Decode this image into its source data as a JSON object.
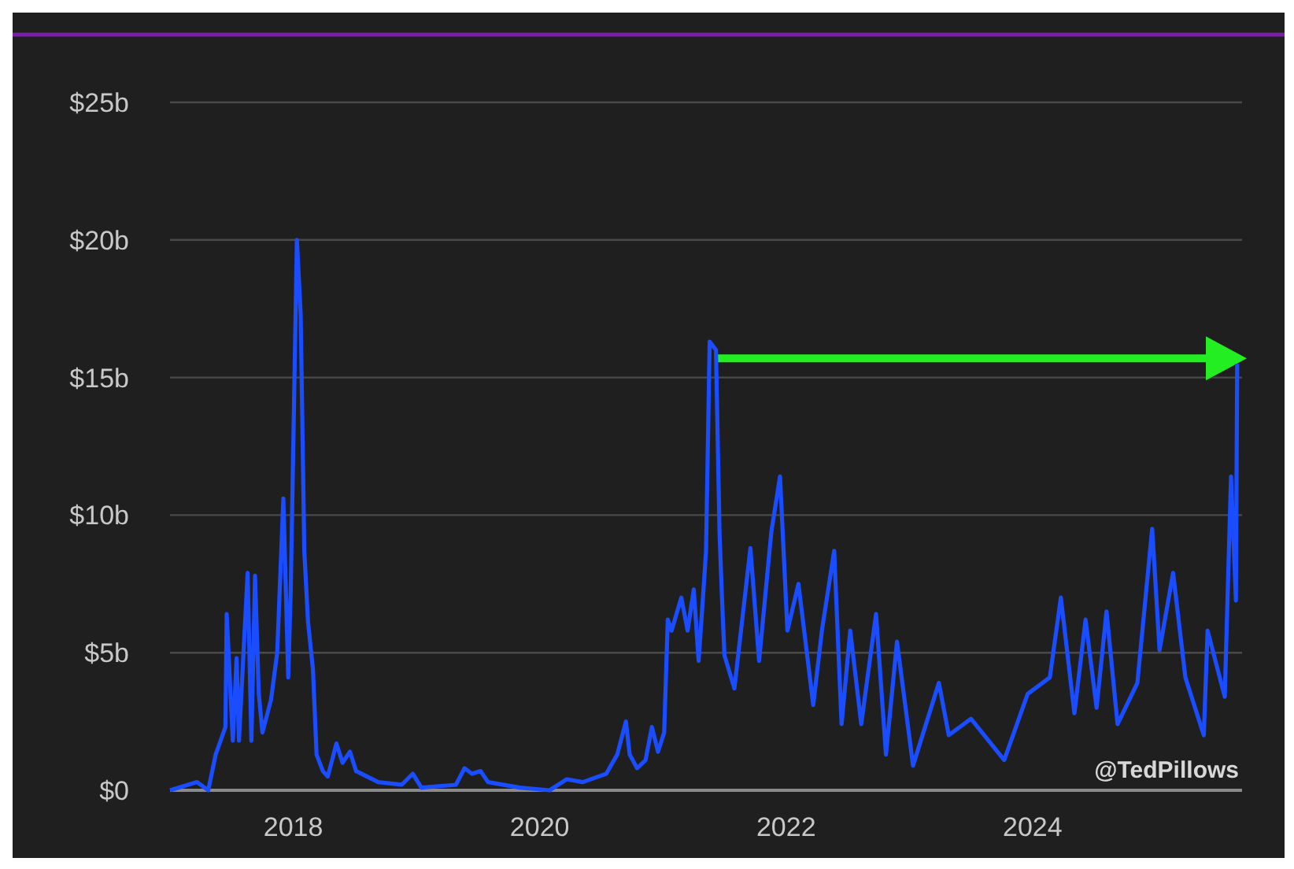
{
  "chart_data": {
    "type": "line",
    "xlim": [
      2017,
      2025.7
    ],
    "ylim": [
      0,
      25
    ],
    "yticks": [
      {
        "value": 0,
        "label": "$0"
      },
      {
        "value": 5,
        "label": "$5b"
      },
      {
        "value": 10,
        "label": "$10b"
      },
      {
        "value": 15,
        "label": "$15b"
      },
      {
        "value": 20,
        "label": "$20b"
      },
      {
        "value": 25,
        "label": "$25b"
      }
    ],
    "xticks": [
      {
        "value": 2018,
        "label": "2018"
      },
      {
        "value": 2020,
        "label": "2020"
      },
      {
        "value": 2022,
        "label": "2022"
      },
      {
        "value": 2024,
        "label": "2024"
      }
    ],
    "x": [
      2017.0,
      2017.22,
      2017.31,
      2017.37,
      2017.45,
      2017.46,
      2017.51,
      2017.54,
      2017.56,
      2017.63,
      2017.66,
      2017.69,
      2017.72,
      2017.75,
      2017.82,
      2017.87,
      2017.92,
      2017.96,
      2017.98,
      2018.03,
      2018.06,
      2018.09,
      2018.12,
      2018.16,
      2018.19,
      2018.24,
      2018.28,
      2018.35,
      2018.4,
      2018.46,
      2018.51,
      2018.69,
      2018.88,
      2018.97,
      2019.04,
      2019.32,
      2019.39,
      2019.45,
      2019.52,
      2019.58,
      2019.84,
      2020.08,
      2020.15,
      2020.22,
      2020.35,
      2020.54,
      2020.63,
      2020.7,
      2020.73,
      2020.79,
      2020.86,
      2020.91,
      2020.96,
      2021.01,
      2021.04,
      2021.07,
      2021.15,
      2021.2,
      2021.25,
      2021.29,
      2021.33,
      2021.35,
      2021.38,
      2021.43,
      2021.46,
      2021.48,
      2021.5,
      2021.58,
      2021.71,
      2021.78,
      2021.88,
      2021.95,
      2022.01,
      2022.1,
      2022.22,
      2022.29,
      2022.39,
      2022.45,
      2022.52,
      2022.61,
      2022.73,
      2022.81,
      2022.9,
      2023.03,
      2023.24,
      2023.32,
      2023.5,
      2023.77,
      2023.96,
      2024.14,
      2024.23,
      2024.34,
      2024.43,
      2024.52,
      2024.6,
      2024.69,
      2024.85,
      2024.97,
      2025.03,
      2025.14,
      2025.24,
      2025.39,
      2025.42,
      2025.56,
      2025.61,
      2025.65,
      2025.66
    ],
    "series": [
      {
        "color": "#1a4dff",
        "values": [
          0,
          0.3,
          0,
          1.3,
          2.3,
          6.4,
          1.8,
          4.8,
          1.8,
          7.9,
          1.8,
          7.8,
          3.5,
          2.1,
          3.3,
          5.0,
          10.6,
          4.1,
          7.3,
          20.0,
          17.3,
          8.7,
          6.1,
          4.4,
          1.3,
          0.7,
          0.5,
          1.7,
          1.0,
          1.4,
          0.7,
          0.3,
          0.2,
          0.6,
          0.1,
          0.2,
          0.8,
          0.6,
          0.7,
          0.3,
          0.1,
          0,
          0.2,
          0.4,
          0.3,
          0.6,
          1.3,
          2.5,
          1.3,
          0.8,
          1.1,
          2.3,
          1.4,
          2.1,
          6.2,
          5.8,
          7.0,
          5.8,
          7.3,
          4.7,
          7.3,
          8.7,
          16.3,
          16.0,
          9.3,
          6.9,
          4.9,
          3.7,
          8.8,
          4.7,
          9.4,
          11.4,
          5.8,
          7.5,
          3.1,
          5.8,
          8.7,
          2.4,
          5.8,
          2.4,
          6.4,
          1.3,
          5.4,
          0.9,
          3.9,
          2.0,
          2.6,
          1.1,
          3.5,
          4.1,
          7.0,
          2.8,
          6.2,
          3.0,
          6.5,
          2.4,
          3.9,
          9.5,
          5.1,
          7.9,
          4.1,
          2.0,
          5.8,
          3.4,
          11.4,
          6.9,
          15.5
        ]
      }
    ],
    "grid": true
  },
  "credit": "@TedPillows"
}
